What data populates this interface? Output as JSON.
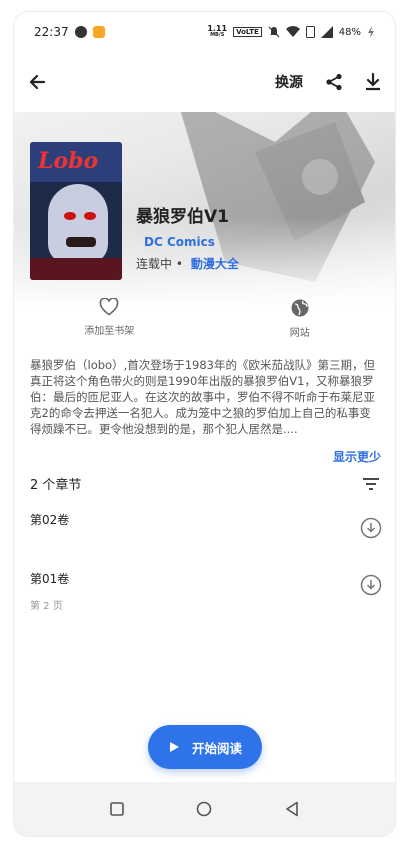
{
  "status_bar": {
    "time": "22:37",
    "net_speed_value": "1.11",
    "net_speed_unit": "MB/S",
    "volte": "VoLTE",
    "battery": "48%"
  },
  "toolbar": {
    "swap_source_label": "换源"
  },
  "manga": {
    "title": "暴狼罗伯V1",
    "author": "DC Comics",
    "status": "连载中 •",
    "source": "動漫大全",
    "description": "暴狼罗伯（lobo）,首次登场于1983年的《欧米茄战队》第三期，但真正将这个角色带火的则是1990年出版的暴狼罗伯V1，又称暴狼罗伯：最后的匝尼亚人。在这次的故事中，罗伯不得不听命于布莱尼亚克2的命令去押送一名犯人。成为笼中之狼的罗伯加上自己的私事变得烦躁不已。更令他没想到的是，那个犯人居然是....",
    "show_less": "显示更少"
  },
  "actions": {
    "favorite_label": "添加至书架",
    "website_label": "网站"
  },
  "chapters": {
    "count_label": "2 个章节",
    "items": [
      {
        "name": "第02卷",
        "sub": ""
      },
      {
        "name": "第01卷",
        "sub": "第 2 页"
      }
    ]
  },
  "fab": {
    "label": "开始阅读"
  },
  "colors": {
    "accent": "#2f73ea"
  }
}
